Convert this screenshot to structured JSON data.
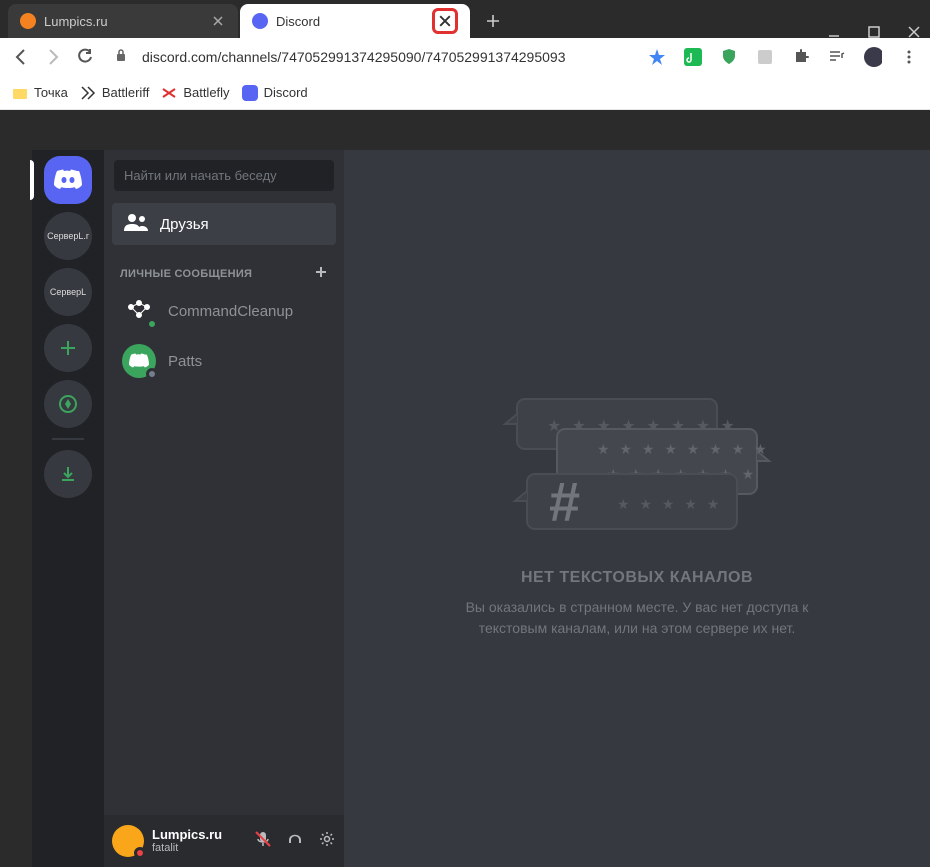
{
  "window": {
    "tabs": [
      {
        "title": "Lumpics.ru",
        "favicon_color": "#f58220",
        "active": false
      },
      {
        "title": "Discord",
        "favicon_color": "#5865f2",
        "active": true,
        "close_highlighted": true
      }
    ],
    "url": "discord.com/channels/747052991374295090/747052991374295093"
  },
  "bookmarks": [
    {
      "label": "Точка",
      "icon_color": "#ffd966"
    },
    {
      "label": "Battleriff",
      "icon_color": "#333"
    },
    {
      "label": "Battlefly",
      "icon_color": "#e03030"
    },
    {
      "label": "Discord",
      "icon_color": "#5865f2"
    }
  ],
  "servers": [
    {
      "type": "home"
    },
    {
      "type": "guild",
      "label": "СерверL.r"
    },
    {
      "type": "guild",
      "label": "СерверL"
    },
    {
      "type": "add"
    },
    {
      "type": "explore"
    },
    {
      "type": "download"
    }
  ],
  "dm_panel": {
    "search_placeholder": "Найти или начать беседу",
    "friends_label": "Друзья",
    "section_header": "ЛИЧНЫЕ СООБЩЕНИЯ",
    "dms": [
      {
        "name": "CommandCleanup",
        "avatar_bg": "#2f3136",
        "status_color": "#3ba55d"
      },
      {
        "name": "Patts",
        "avatar_bg": "#3ba55d",
        "status_color": "#747f8d"
      }
    ]
  },
  "user": {
    "name": "Lumpics.ru",
    "tag": "fatalit",
    "status_color": "#ed4245"
  },
  "main": {
    "empty_title": "НЕТ ТЕКСТОВЫХ КАНАЛОВ",
    "empty_desc": "Вы оказались в странном месте. У вас нет доступа к текстовым каналам, или на этом сервере их нет."
  },
  "ext_colors": {
    "star": "#4285f4",
    "music": "#1db954",
    "shield": "#3ba55d"
  }
}
